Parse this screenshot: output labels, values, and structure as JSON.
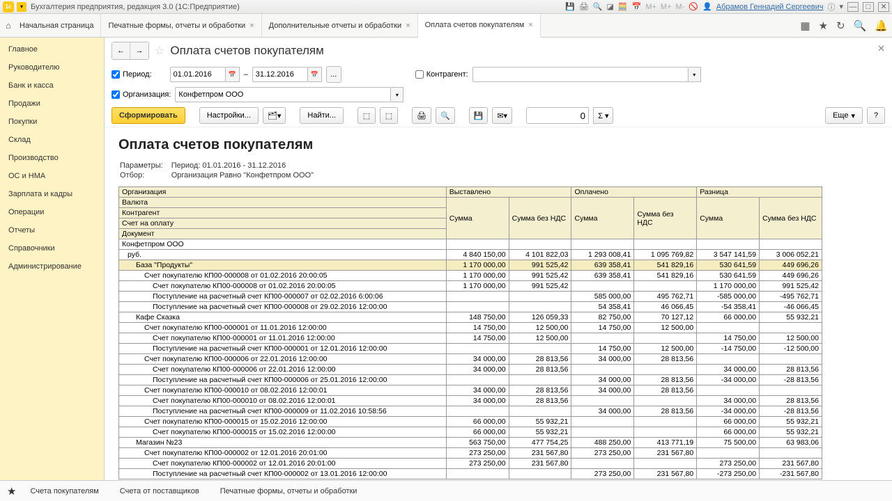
{
  "titlebar": {
    "app_title": "Бухгалтерия предприятия, редакция 3.0  (1С:Предприятие)",
    "logo_text": "1с",
    "user_name": "Абрамов Геннадий Сергеевич"
  },
  "tabs": [
    {
      "label": "Начальная страница",
      "home": true,
      "closable": false
    },
    {
      "label": "Печатные формы, отчеты и обработки",
      "closable": true
    },
    {
      "label": "Дополнительные отчеты и обработки",
      "closable": true
    },
    {
      "label": "Оплата счетов покупателям",
      "closable": true,
      "active": true
    }
  ],
  "sidebar": {
    "items": [
      "Главное",
      "Руководителю",
      "Банк и касса",
      "Продажи",
      "Покупки",
      "Склад",
      "Производство",
      "ОС и НМА",
      "Зарплата и кадры",
      "Операции",
      "Отчеты",
      "Справочники",
      "Администрирование"
    ]
  },
  "page": {
    "title": "Оплата счетов покупателям"
  },
  "filters": {
    "period_label": "Период:",
    "date_from": "01.01.2016",
    "date_to": "31.12.2016",
    "dash": "–",
    "ellipsis": "...",
    "counterparty_label": "Контрагент:",
    "counterparty_value": "",
    "org_label": "Организация:",
    "org_value": "Конфетпром ООО"
  },
  "toolbar": {
    "form": "Сформировать",
    "settings": "Настройки...",
    "find": "Найти...",
    "sum_input": "0",
    "more": "Еще",
    "help": "?"
  },
  "report": {
    "title": "Оплата счетов покупателям",
    "params_label": "Параметры:",
    "params_value": "Период: 01.01.2016 - 31.12.2016",
    "filter_label": "Отбор:",
    "filter_value": "Организация Равно \"Конфетпром ООО\"",
    "header": {
      "col1_rows": [
        "Организация",
        "Валюта",
        "Контрагент",
        "Счет на оплату",
        "Документ"
      ],
      "groups": [
        "Выставлено",
        "Оплачено",
        "Разница"
      ],
      "sub": [
        "Сумма",
        "Сумма без НДС"
      ]
    },
    "rows": [
      {
        "lvl": 0,
        "name": "Конфетпром ООО"
      },
      {
        "lvl": 1,
        "name": "руб.",
        "v": [
          "4 840 150,00",
          "4 101 822,03",
          "1 293 008,41",
          "1 095 769,82",
          "3 547 141,59",
          "3 006 052,21"
        ]
      },
      {
        "lvl": 2,
        "name": "База \"Продукты\"",
        "v": [
          "1 170 000,00",
          "991 525,42",
          "639 358,41",
          "541 829,16",
          "530 641,59",
          "449 696,26"
        ],
        "sel": true
      },
      {
        "lvl": 3,
        "name": "Счет покупателю КП00-000008 от 01.02.2016 20:00:05",
        "v": [
          "1 170 000,00",
          "991 525,42",
          "639 358,41",
          "541 829,16",
          "530 641,59",
          "449 696,26"
        ]
      },
      {
        "lvl": 4,
        "name": "Счет покупателю КП00-000008 от 01.02.2016 20:00:05",
        "v": [
          "1 170 000,00",
          "991 525,42",
          "",
          "",
          "1 170 000,00",
          "991 525,42"
        ]
      },
      {
        "lvl": 4,
        "name": "Поступление на расчетный счет КП00-000007 от 02.02.2016 6:00:06",
        "v": [
          "",
          "",
          "585 000,00",
          "495 762,71",
          "-585 000,00",
          "-495 762,71"
        ]
      },
      {
        "lvl": 4,
        "name": "Поступление на расчетный счет КП00-000008 от 29.02.2016 12:00:00",
        "v": [
          "",
          "",
          "54 358,41",
          "46 066,45",
          "-54 358,41",
          "-46 066,45"
        ]
      },
      {
        "lvl": 2,
        "name": "Кафе Сказка",
        "v": [
          "148 750,00",
          "126 059,33",
          "82 750,00",
          "70 127,12",
          "66 000,00",
          "55 932,21"
        ]
      },
      {
        "lvl": 3,
        "name": "Счет покупателю КП00-000001 от 11.01.2016 12:00:00",
        "v": [
          "14 750,00",
          "12 500,00",
          "14 750,00",
          "12 500,00",
          "",
          ""
        ]
      },
      {
        "lvl": 4,
        "name": "Счет покупателю КП00-000001 от 11.01.2016 12:00:00",
        "v": [
          "14 750,00",
          "12 500,00",
          "",
          "",
          "14 750,00",
          "12 500,00"
        ]
      },
      {
        "lvl": 4,
        "name": "Поступление на расчетный счет КП00-000001 от 12.01.2016 12:00:00",
        "v": [
          "",
          "",
          "14 750,00",
          "12 500,00",
          "-14 750,00",
          "-12 500,00"
        ]
      },
      {
        "lvl": 3,
        "name": "Счет покупателю КП00-000006 от 22.01.2016 12:00:00",
        "v": [
          "34 000,00",
          "28 813,56",
          "34 000,00",
          "28 813,56",
          "",
          ""
        ]
      },
      {
        "lvl": 4,
        "name": "Счет покупателю КП00-000006 от 22.01.2016 12:00:00",
        "v": [
          "34 000,00",
          "28 813,56",
          "",
          "",
          "34 000,00",
          "28 813,56"
        ]
      },
      {
        "lvl": 4,
        "name": "Поступление на расчетный счет КП00-000006 от 25.01.2016 12:00:00",
        "v": [
          "",
          "",
          "34 000,00",
          "28 813,56",
          "-34 000,00",
          "-28 813,56"
        ]
      },
      {
        "lvl": 3,
        "name": "Счет покупателю КП00-000010 от 08.02.2016 12:00:01",
        "v": [
          "34 000,00",
          "28 813,56",
          "34 000,00",
          "28 813,56",
          "",
          ""
        ]
      },
      {
        "lvl": 4,
        "name": "Счет покупателю КП00-000010 от 08.02.2016 12:00:01",
        "v": [
          "34 000,00",
          "28 813,56",
          "",
          "",
          "34 000,00",
          "28 813,56"
        ]
      },
      {
        "lvl": 4,
        "name": "Поступление на расчетный счет КП00-000009 от 11.02.2016 10:58:56",
        "v": [
          "",
          "",
          "34 000,00",
          "28 813,56",
          "-34 000,00",
          "-28 813,56"
        ]
      },
      {
        "lvl": 3,
        "name": "Счет покупателю КП00-000015 от 15.02.2016 12:00:00",
        "v": [
          "66 000,00",
          "55 932,21",
          "",
          "",
          "66 000,00",
          "55 932,21"
        ]
      },
      {
        "lvl": 4,
        "name": "Счет покупателю КП00-000015 от 15.02.2016 12:00:00",
        "v": [
          "66 000,00",
          "55 932,21",
          "",
          "",
          "66 000,00",
          "55 932,21"
        ]
      },
      {
        "lvl": 2,
        "name": "Магазин №23",
        "v": [
          "563 750,00",
          "477 754,25",
          "488 250,00",
          "413 771,19",
          "75 500,00",
          "63 983,06"
        ]
      },
      {
        "lvl": 3,
        "name": "Счет покупателю КП00-000002 от 12.01.2016 20:01:00",
        "v": [
          "273 250,00",
          "231 567,80",
          "273 250,00",
          "231 567,80",
          "",
          ""
        ]
      },
      {
        "lvl": 4,
        "name": "Счет покупателю КП00-000002 от 12.01.2016 20:01:00",
        "v": [
          "273 250,00",
          "231 567,80",
          "",
          "",
          "273 250,00",
          "231 567,80"
        ]
      },
      {
        "lvl": 4,
        "name": "Поступление на расчетный счет КП00-000002 от 13.01.2016 12:00:00",
        "v": [
          "",
          "",
          "273 250,00",
          "231 567,80",
          "-273 250,00",
          "-231 567,80"
        ]
      }
    ]
  },
  "taskbar": {
    "items": [
      "Счета покупателям",
      "Счета от поставщиков",
      "Печатные формы, отчеты и обработки"
    ]
  }
}
